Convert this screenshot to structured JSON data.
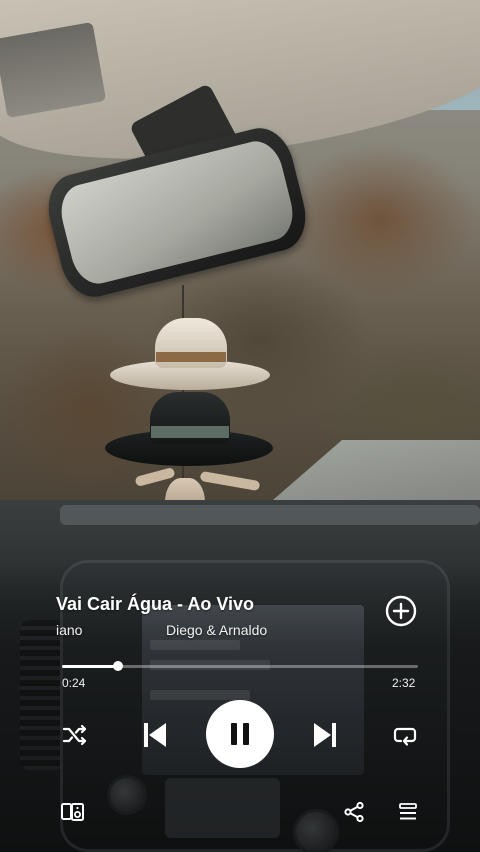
{
  "track": {
    "title": "Vai Cair Água - Ao Vivo",
    "artist_left": "iano",
    "artist_right": "Diego & Arnaldo"
  },
  "playback": {
    "elapsed": "0:24",
    "duration": "2:32",
    "progress_fraction": 0.158,
    "state": "playing"
  },
  "icons": {
    "add": "plus-circle-icon",
    "shuffle": "shuffle-icon",
    "previous": "skip-back-icon",
    "pause": "pause-icon",
    "next": "skip-forward-icon",
    "repeat": "repeat-icon",
    "devices": "connect-device-icon",
    "share": "share-icon",
    "queue": "queue-icon"
  },
  "colors": {
    "controls": "#ffffff",
    "play_button_bg": "#ffffff",
    "play_button_icon": "#111111"
  }
}
